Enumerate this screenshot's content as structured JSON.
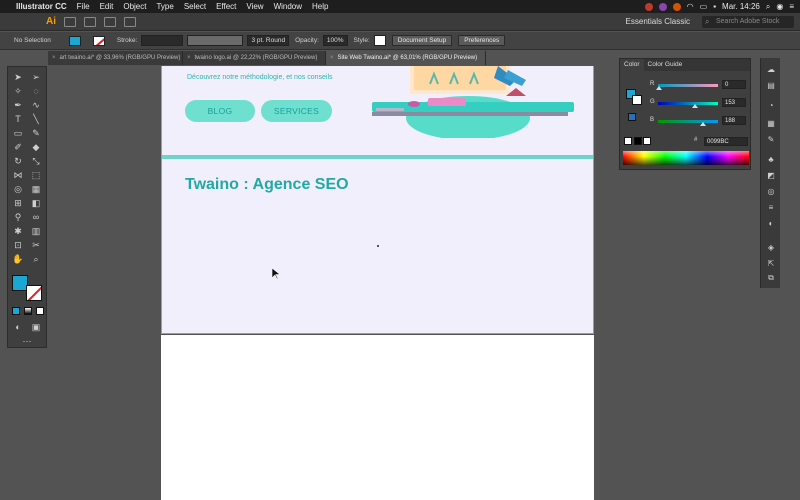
{
  "menubar": {
    "app": "Illustrator CC",
    "items": [
      "File",
      "Edit",
      "Object",
      "Type",
      "Select",
      "Effect",
      "View",
      "Window",
      "Help"
    ],
    "clock": "Mar. 14:26"
  },
  "appbar": {
    "logo": "Ai",
    "workspace": "Essentials Classic",
    "search_placeholder": "Search Adobe Stock"
  },
  "controlbar": {
    "selection": "No Selection",
    "stroke_label": "Stroke:",
    "brush": "3 pt. Round",
    "opacity_label": "Opacity:",
    "opacity_value": "100%",
    "style_label": "Style:",
    "doc_setup": "Document Setup",
    "preferences": "Preferences"
  },
  "tabs": [
    {
      "label": "art twaino.ai* @ 33,96% (RGB/GPU Preview)",
      "active": false
    },
    {
      "label": "twaino logo.ai @ 22,22% (RGB/GPU Preview)",
      "active": false
    },
    {
      "label": "Site Web Twaino.ai* @ 63,01% (RGB/GPU Preview)",
      "active": true
    }
  ],
  "artboard": {
    "tagline": "Découvrez notre méthodologie, et nos conseils",
    "button_blog": "BLOG",
    "button_services": "SERVICES",
    "headline": "Twaino : Agence SEO"
  },
  "color_panel": {
    "tab_color": "Color",
    "tab_guide": "Color Guide",
    "r_label": "R",
    "r_value": "0",
    "g_label": "G",
    "g_value": "153",
    "b_label": "B",
    "b_value": "188",
    "hex": "0099BC"
  },
  "colors": {
    "accent": "#1aa7d4",
    "teal": "#22a9a5",
    "button_bg": "#6fdfcf"
  }
}
